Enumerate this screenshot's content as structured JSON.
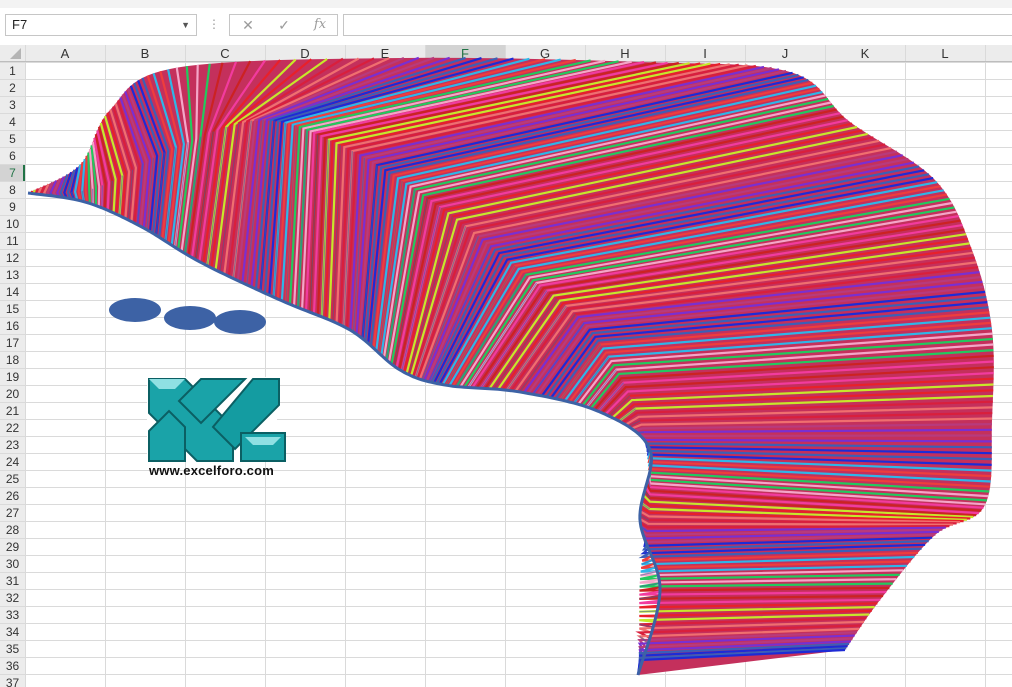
{
  "formula_bar": {
    "name_box": "F7",
    "cancel_icon": "✕",
    "enter_icon": "✓",
    "fx_label": "fx",
    "formula_value": ""
  },
  "sheet": {
    "columns": [
      "A",
      "B",
      "C",
      "D",
      "E",
      "F",
      "G",
      "H",
      "I",
      "J",
      "K",
      "L"
    ],
    "rows": [
      "1",
      "2",
      "3",
      "4",
      "5",
      "6",
      "7",
      "8",
      "9",
      "10",
      "11",
      "12",
      "13",
      "14",
      "15",
      "16",
      "17",
      "18",
      "19",
      "20",
      "21",
      "22",
      "23",
      "24",
      "25",
      "26",
      "27",
      "28",
      "29",
      "30",
      "31",
      "32",
      "33",
      "34",
      "35",
      "36",
      "37"
    ],
    "selected_column": "F",
    "selected_row": "7"
  },
  "logo": {
    "url_text": "www.excelforo.com",
    "color": "#1aa3a8"
  },
  "colors": {
    "grid_line": "#dadada",
    "header_bg": "#ececec",
    "header_selected_bg": "#d3d3d3",
    "header_selected_text": "#217346",
    "artwork_palette": [
      "#e8202a",
      "#d91f3c",
      "#b83a7d",
      "#3b5fb7",
      "#2fb6e8",
      "#23c95e",
      "#f23b9e",
      "#c7e72b",
      "#f06f6f",
      "#7a2fd1",
      "#1d2bd6",
      "#ee3d3d",
      "#f4a6c8",
      "#cc2222"
    ],
    "artwork_edge": "#3d62a5"
  }
}
